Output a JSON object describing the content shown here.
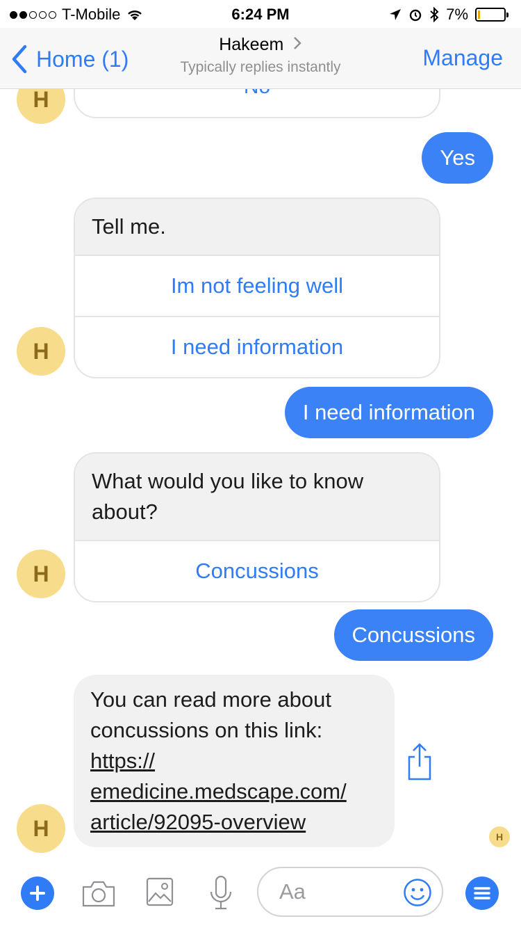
{
  "status_bar": {
    "carrier": "T-Mobile",
    "time": "6:24 PM",
    "battery_percent": "7%",
    "battery_level": 0.07
  },
  "nav": {
    "back_label": "Home (1)",
    "title": "Hakeem",
    "subtitle": "Typically replies instantly",
    "manage_label": "Manage"
  },
  "avatar_letter": "H",
  "messages": {
    "partial_option": "No",
    "me_1": "Yes",
    "card_1": {
      "text": "Tell me.",
      "options": [
        "Im not feeling well",
        "I need information"
      ]
    },
    "me_2": "I need information",
    "card_2": {
      "text": "What would you like to know about?",
      "options": [
        "Concussions"
      ]
    },
    "me_3": "Concussions",
    "them_1": {
      "text": "You can read more about concussions on this link:",
      "link_line_1": "https://",
      "link_line_2": "emedicine.medscape.com/",
      "link_line_3": "article/92095-overview"
    }
  },
  "composer": {
    "placeholder": "Aa"
  },
  "icons": {
    "plus": "plus-icon",
    "camera": "camera-icon",
    "photo": "photo-icon",
    "microphone": "microphone-icon",
    "smiley": "smiley-icon",
    "menu": "menu-icon",
    "share": "share-icon"
  },
  "colors": {
    "accent": "#2f7cf6",
    "bubble_me": "#3b82f6",
    "bubble_them": "#f1f1f1",
    "avatar": "#f7dc8c"
  }
}
